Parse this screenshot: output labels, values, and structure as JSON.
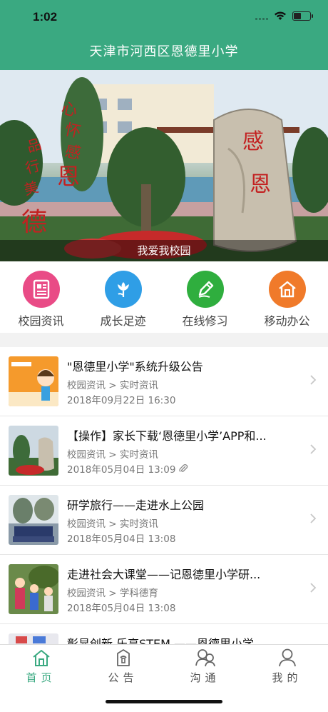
{
  "status": {
    "time": "1:02",
    "battery_level": 0.5
  },
  "header": {
    "title": "天津市河西区恩德里小学"
  },
  "banner": {
    "caption": "我爱我校园",
    "rock_text": "感恩",
    "calligraphy_text": "心怀感恩 品行美德"
  },
  "menu": [
    {
      "label": "校园资讯",
      "icon": "news-icon",
      "color": "#e94b86"
    },
    {
      "label": "成长足迹",
      "icon": "flower-icon",
      "color": "#2f9ee6"
    },
    {
      "label": "在线修习",
      "icon": "pencil-icon",
      "color": "#2fae3e"
    },
    {
      "label": "移动办公",
      "icon": "home-office-icon",
      "color": "#f07a2a"
    }
  ],
  "news": [
    {
      "title": "\"恩德里小学\"系统升级公告",
      "category": "校园资讯 > 实时资讯",
      "date": "2018年09月22日 16:30",
      "attachment": false
    },
    {
      "title": "【操作】家长下载‘恩德里小学’APP和...",
      "category": "校园资讯 > 实时资讯",
      "date": "2018年05月04日 13:09",
      "attachment": true
    },
    {
      "title": "研学旅行——走进水上公园",
      "category": "校园资讯 > 实时资讯",
      "date": "2018年05月04日 13:08",
      "attachment": false
    },
    {
      "title": "走进社会大课堂——记恩德里小学研...",
      "category": "校园资讯 > 学科德育",
      "date": "2018年05月04日 13:08",
      "attachment": false
    },
    {
      "title": "彰显创新 乐享STEM ——恩德里小学",
      "category": "",
      "date": "",
      "attachment": false
    }
  ],
  "tabs": [
    {
      "label": "首页",
      "icon": "home-icon",
      "active": true
    },
    {
      "label": "公告",
      "icon": "notice-icon",
      "active": false
    },
    {
      "label": "沟通",
      "icon": "chat-icon",
      "active": false
    },
    {
      "label": "我的",
      "icon": "user-icon",
      "active": false
    }
  ],
  "colors": {
    "brand": "#3aa981"
  }
}
